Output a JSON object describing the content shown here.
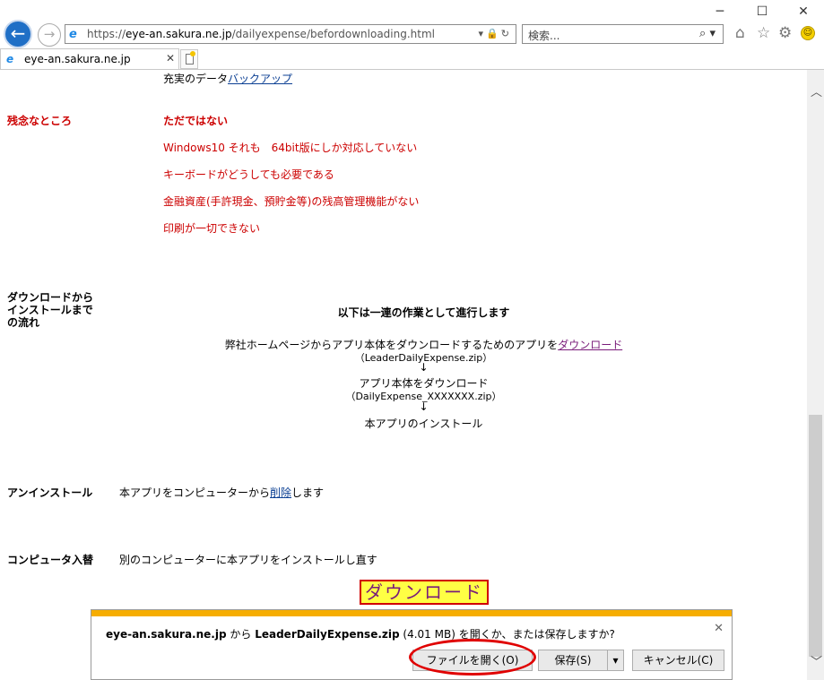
{
  "browser": {
    "url_prefix": "https://",
    "url_host": "eye-an.sakura.ne.jp",
    "url_path": "/dailyexpense/befordownloading.html",
    "search_placeholder": "検索...",
    "tab_title": "eye-an.sakura.ne.jp",
    "window_controls": {
      "minimize": "─",
      "maximize": "☐",
      "close": "✕"
    }
  },
  "content": {
    "feature_prefix": "充実のデータ",
    "feature_link": "バックアップ",
    "cons_label": "残念なところ",
    "cons": [
      "ただではない",
      "Windows10 それも　64bit版にしか対応していない",
      "キーボードがどうしても必要である",
      "金融資産(手許現金、預貯金等)の残高管理機能がない",
      "印刷が一切できない"
    ],
    "flow_label_lines": [
      "ダウンロードから",
      "インストールまで",
      "の流れ"
    ],
    "flow_heading": "以下は一連の作業として進行します",
    "flow_step1_prefix": "弊社ホームページからアプリ本体をダウンロードするためのアプリを",
    "flow_step1_link": "ダウンロード",
    "flow_step1_file": "（LeaderDailyExpense.zip）",
    "arrow": "↓",
    "flow_step2": "アプリ本体をダウンロード",
    "flow_step2_file": "（DailyExpense_XXXXXXX.zip）",
    "flow_step3": "本アプリのインストール",
    "uninstall_label": "アンインストール",
    "uninstall_prefix": "本アプリをコンピューターから",
    "uninstall_link": "削除",
    "uninstall_suffix": "します",
    "reinstall_label": "コンピュータ入替",
    "reinstall_text": "別のコンピューターに本アプリをインストールし直す",
    "download_button": "ダウンロード"
  },
  "notification": {
    "host": "eye-an.sakura.ne.jp",
    "from": " から ",
    "file": "LeaderDailyExpense.zip",
    "size": " (4.01 MB) ",
    "question": "を開くか、または保存しますか?",
    "open_button": "ファイルを開く(O)",
    "save_button": "保存(S)",
    "cancel_button": "キャンセル(C)"
  }
}
